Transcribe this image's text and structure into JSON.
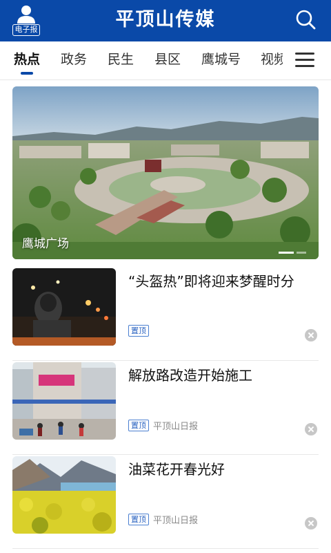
{
  "app": {
    "brand": "平顶山传媒",
    "epaper_label": "电子报",
    "accent_color": "#0a49a8",
    "search_icon": "search-icon",
    "menu_icon": "hamburger-icon"
  },
  "tabs": [
    {
      "label": "热点",
      "active": true
    },
    {
      "label": "政务",
      "active": false
    },
    {
      "label": "民生",
      "active": false
    },
    {
      "label": "县区",
      "active": false
    },
    {
      "label": "鹰城号",
      "active": false
    },
    {
      "label": "视频",
      "active": false
    }
  ],
  "hero": {
    "caption": "鹰城广场",
    "carousel_index": 1
  },
  "news": [
    {
      "title": "“头盔热”即将迎来梦醒时分",
      "pin": "置顶",
      "source": ""
    },
    {
      "title": "解放路改造开始施工",
      "pin": "置顶",
      "source": "平顶山日报"
    },
    {
      "title": "油菜花开春光好",
      "pin": "置顶",
      "source": "平顶山日报"
    }
  ]
}
